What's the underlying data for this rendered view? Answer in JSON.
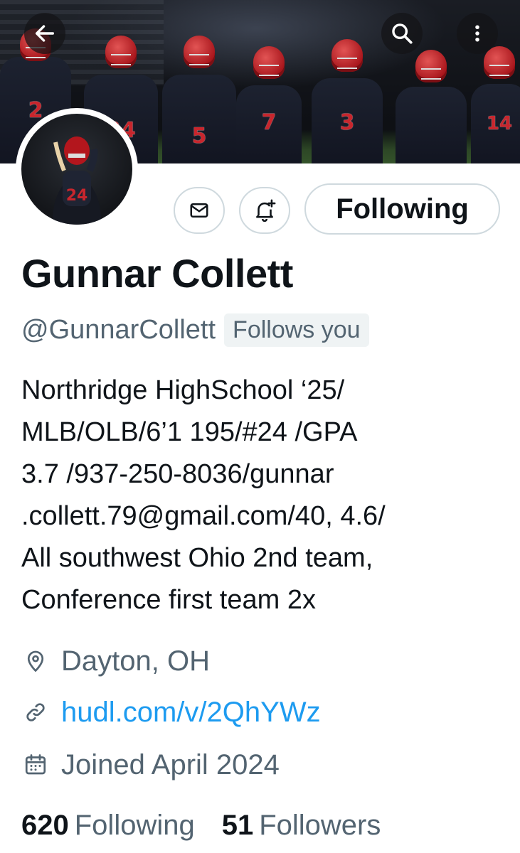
{
  "profile": {
    "name": "Gunnar Collett",
    "handle": "@GunnarCollett",
    "follows_you": "Follows you",
    "bio": "Northridge HighSchool ‘25/\nMLB/OLB/6’1 195/#24 /GPA\n3.7 /937-250-8036/gunnar\n.collett.79@gmail.com/40, 4.6/\nAll southwest Ohio 2nd team,\nConference first team 2x",
    "location": "Dayton, OH",
    "website": "hudl.com/v/2QhYWz",
    "joined": "Joined April 2024"
  },
  "actions": {
    "follow_state": "Following"
  },
  "stats": {
    "following_count": "620",
    "following_label": "Following",
    "followers_count": "51",
    "followers_label": "Followers"
  },
  "banner": {
    "jersey_numbers": [
      "2",
      "24",
      "5",
      "7",
      "3",
      "",
      "14"
    ]
  },
  "icons": {
    "back": "back-arrow-icon",
    "search": "search-icon",
    "more": "more-vertical-icon",
    "message": "envelope-icon",
    "notify": "bell-plus-icon",
    "location": "location-pin-icon",
    "link": "link-icon",
    "calendar": "calendar-icon"
  },
  "colors": {
    "accent_link": "#1d9bf0",
    "secondary_text": "#536471",
    "primary_text": "#0f1419",
    "border": "#cfd9de"
  }
}
